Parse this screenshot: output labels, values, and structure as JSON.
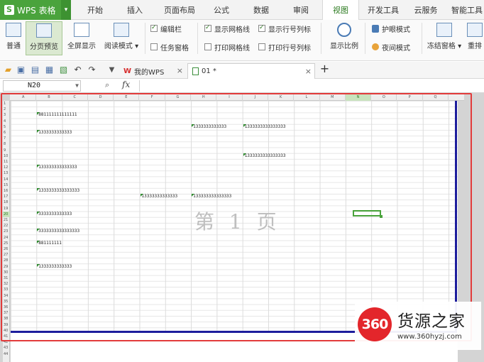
{
  "app": {
    "name": "WPS 表格",
    "caret": "▾"
  },
  "menu_tabs": [
    {
      "label": "开始"
    },
    {
      "label": "插入"
    },
    {
      "label": "页面布局"
    },
    {
      "label": "公式"
    },
    {
      "label": "数据"
    },
    {
      "label": "审阅"
    },
    {
      "label": "视图",
      "active": true
    },
    {
      "label": "开发工具"
    },
    {
      "label": "云服务"
    },
    {
      "label": "智能工具"
    }
  ],
  "ribbon": {
    "normal": "普通",
    "page_break_preview": "分页预览",
    "fullscreen": "全屏显示",
    "reading_mode": "阅读模式",
    "edit_bar": {
      "label": "编辑栏",
      "checked": true
    },
    "task_pane": {
      "label": "任务窗格",
      "checked": false
    },
    "show_gridlines": {
      "label": "显示网格线",
      "checked": true
    },
    "print_gridlines": {
      "label": "打印网格线",
      "checked": false
    },
    "show_row_col_headers": {
      "label": "显示行号列标",
      "checked": true
    },
    "print_row_col_headers": {
      "label": "打印行号列标",
      "checked": false
    },
    "zoom": "显示比例",
    "eye_protection": "护眼模式",
    "night_mode": "夜间模式",
    "freeze_panes": "冻结窗格",
    "rearrange": "重排"
  },
  "doc_tabs": [
    {
      "label": "我的WPS"
    },
    {
      "label": "01 *",
      "active": true
    }
  ],
  "add_tab": "+",
  "formula_bar": {
    "name_box": "N20",
    "fx": "fx"
  },
  "sheet": {
    "columns": [
      "A",
      "B",
      "C",
      "D",
      "E",
      "F",
      "G",
      "H",
      "I",
      "J",
      "K",
      "L",
      "M",
      "N",
      "O",
      "P",
      "Q"
    ],
    "selected_column": "N",
    "selected_row": "20",
    "rows": [
      "1",
      "2",
      "3",
      "4",
      "5",
      "6",
      "7",
      "8",
      "9",
      "10",
      "11",
      "12",
      "13",
      "14",
      "15",
      "16",
      "17",
      "18",
      "19",
      "20",
      "21",
      "22",
      "23",
      "24",
      "25",
      "26",
      "27",
      "28",
      "29",
      "30",
      "31",
      "32",
      "33",
      "34",
      "35",
      "36",
      "37",
      "38",
      "39",
      "40",
      "41",
      "42",
      "43",
      "44"
    ],
    "page_watermark": "第 1 页",
    "cells": [
      {
        "ref": "B3",
        "value": "881111111111111"
      },
      {
        "ref": "B6",
        "value": "1333333333333"
      },
      {
        "ref": "H5",
        "value": "1333333333333"
      },
      {
        "ref": "J5",
        "value": "1333333333333333"
      },
      {
        "ref": "J10",
        "value": "1333333333333333"
      },
      {
        "ref": "B12",
        "value": "133333333333333"
      },
      {
        "ref": "B16",
        "value": "1333333333333333"
      },
      {
        "ref": "F17",
        "value": "13333333333333"
      },
      {
        "ref": "H17",
        "value": "133333333333333"
      },
      {
        "ref": "B20",
        "value": "3333333333333"
      },
      {
        "ref": "B23",
        "value": "3333333333333333"
      },
      {
        "ref": "B25",
        "value": "881111111"
      },
      {
        "ref": "B29",
        "value": "1333333333333"
      }
    ]
  },
  "site_logo": {
    "badge": "360",
    "name": "货源之家",
    "url": "www.360hyzj.com"
  },
  "colors": {
    "accent": "#4aa33c",
    "page_border": "#1d1d9c",
    "highlight": "#e23b3b",
    "logo_red": "#e3262b"
  }
}
